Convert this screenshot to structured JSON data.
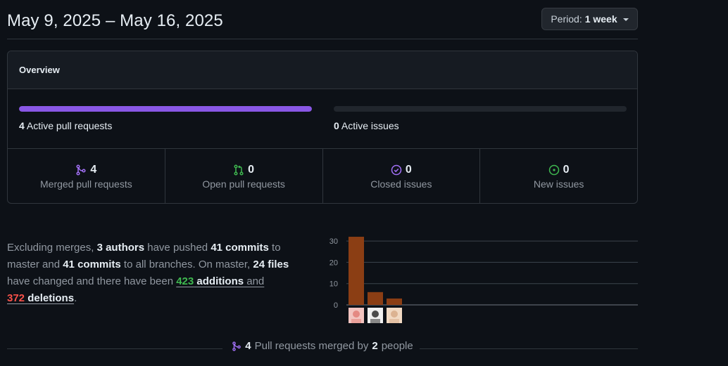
{
  "header": {
    "title": "May 9, 2025 – May 16, 2025",
    "period_prefix": "Period:",
    "period_value": "1 week"
  },
  "overview": {
    "title": "Overview",
    "pull_requests": {
      "count": "4",
      "label": "Active pull requests",
      "fill_fraction": 1.0
    },
    "issues": {
      "count": "0",
      "label": "Active issues",
      "fill_fraction": 0.0
    },
    "stats": [
      {
        "icon": "merge-icon",
        "value": "4",
        "label": "Merged pull requests",
        "color": "#a371f7"
      },
      {
        "icon": "open-pr-icon",
        "value": "0",
        "label": "Open pull requests",
        "color": "#3fb950"
      },
      {
        "icon": "closed-issue-icon",
        "value": "0",
        "label": "Closed issues",
        "color": "#a371f7"
      },
      {
        "icon": "new-issue-icon",
        "value": "0",
        "label": "New issues",
        "color": "#3fb950"
      }
    ]
  },
  "summary": {
    "t1": "Excluding merges, ",
    "authors": "3 authors",
    "t2": " have pushed ",
    "commits_master": "41 commits",
    "t3": " to master and ",
    "commits_all": "41 commits",
    "t4": " to all branches. On master, ",
    "files": "24 files",
    "t5": " have changed and there have been ",
    "additions_count": "423",
    "additions_word": "additions",
    "t6": " and",
    "deletions_count": "372",
    "deletions_word": "deletions",
    "t7": "."
  },
  "chart_data": {
    "type": "bar",
    "categories": [
      "author-1",
      "author-2",
      "author-3"
    ],
    "values": [
      32,
      6,
      3
    ],
    "yticks": [
      0,
      10,
      20,
      30
    ],
    "ylim": [
      0,
      33
    ],
    "bar_color": "#8b3e14",
    "title": "",
    "xlabel": "",
    "ylabel": ""
  },
  "footer": {
    "count": "4",
    "t1": "Pull requests merged by",
    "people": "2",
    "t2": "people"
  },
  "colors": {
    "accent_purple": "#8957e5",
    "success_green": "#3fb950",
    "danger_red": "#f85149"
  }
}
